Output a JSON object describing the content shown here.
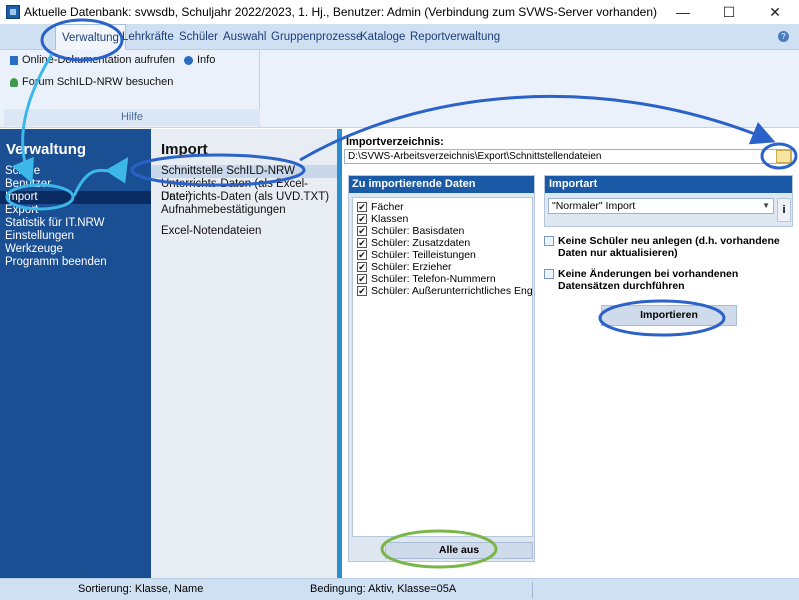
{
  "window": {
    "title": "Aktuelle Datenbank: svwsdb, Schuljahr 2022/2023, 1. Hj., Benutzer: Admin (Verbindung zum SVWS-Server vorhanden)",
    "minimize": "—",
    "maximize": "☐",
    "close": "✕"
  },
  "menu": {
    "items": [
      "Verwaltung",
      "Lehrkräfte",
      "Schüler",
      "Auswahl",
      "Gruppenprozesse",
      "Kataloge",
      "Reportverwaltung"
    ],
    "help_icon": "help-icon"
  },
  "ribbon": {
    "online_doc": "Online-Dokumentation aufrufen",
    "info": "Info",
    "forum": "Forum SchILD-NRW besuchen",
    "group_label": "Hilfe"
  },
  "nav": {
    "title": "Verwaltung",
    "items": [
      "Schule",
      "Benutzer",
      "Import",
      "Export",
      "Statistik für IT.NRW",
      "Einstellungen",
      "Werkzeuge",
      "Programm beenden"
    ],
    "active": "Import"
  },
  "subnav": {
    "title": "Import",
    "items": [
      "Schnittstelle SchILD-NRW",
      "Unterrichts-Daten (als Excel-Datei)",
      "Unterrichts-Daten (als UVD.TXT)",
      "Aufnahmebestätigungen",
      "Excel-Notendateien"
    ],
    "active": "Schnittstelle SchILD-NRW"
  },
  "content": {
    "import_dir_label": "Importverzeichnis:",
    "import_dir_value": "D:\\SVWS-Arbeitsverzeichnis\\Export\\Schnittstellendateien",
    "list_header": "Zu importierende Daten",
    "list_items": [
      "Fächer",
      "Klassen",
      "Schüler: Basisdaten",
      "Schüler: Zusatzdaten",
      "Schüler: Teilleistungen",
      "Schüler: Erzieher",
      "Schüler: Telefon-Nummern",
      "Schüler: Außerunterrichtliches Engagement"
    ],
    "check_mark": "✔",
    "alle_aus": "Alle aus",
    "importart_header": "Importart",
    "importart_value": "\"Normaler\" Import",
    "info_btn": "i",
    "option1": "Keine Schüler neu anlegen (d.h. vorhandene Daten nur aktualisieren)",
    "option2": "Keine Änderungen bei vorhandenen Datensätzen durchführen",
    "importieren": "Importieren"
  },
  "status": {
    "sort": "Sortierung: Klasse, Name",
    "condition": "Bedingung: Aktiv, Klasse=05A"
  },
  "colors": {
    "nav_bg": "#1a4f94",
    "panel_header": "#1a5aa6",
    "annotation_blue": "#2b62c8",
    "annotation_cyan": "#3db7e8",
    "annotation_green": "#7ab648"
  }
}
